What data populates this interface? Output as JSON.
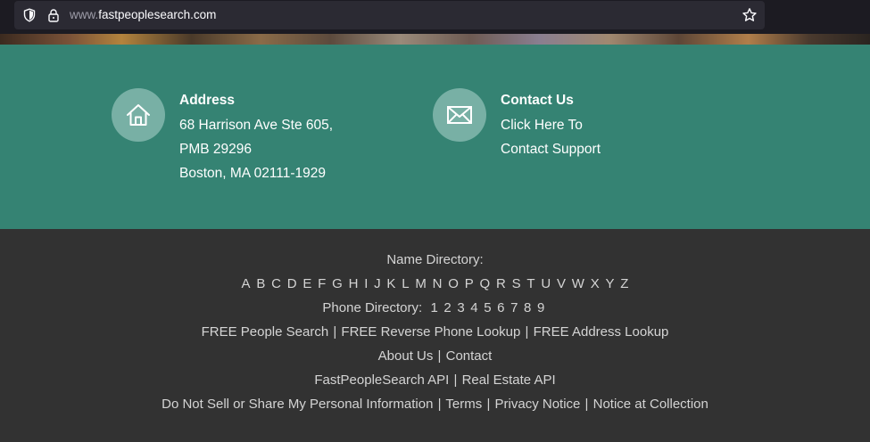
{
  "browser": {
    "url_host_prefix": "www.",
    "url_domain": "fastpeoplesearch.com"
  },
  "contact_band": {
    "address": {
      "heading": "Address",
      "line1": "68 Harrison Ave Ste 605,",
      "line2": "PMB 29296",
      "line3": "Boston, MA 02111-1929",
      "icon": "house-icon"
    },
    "contact": {
      "heading": "Contact Us",
      "line1": "Click Here To",
      "line2": "Contact Support",
      "icon": "envelope-icon"
    },
    "colors": {
      "band": "#358373",
      "icon_circle": "#78b0a5"
    }
  },
  "footer": {
    "name_directory_label": "Name Directory:",
    "letters": [
      "A",
      "B",
      "C",
      "D",
      "E",
      "F",
      "G",
      "H",
      "I",
      "J",
      "K",
      "L",
      "M",
      "N",
      "O",
      "P",
      "Q",
      "R",
      "S",
      "T",
      "U",
      "V",
      "W",
      "X",
      "Y",
      "Z"
    ],
    "phone_directory_label": "Phone Directory:",
    "digits": [
      "1",
      "2",
      "3",
      "4",
      "5",
      "6",
      "7",
      "8",
      "9"
    ],
    "free_people_search": "FREE People Search",
    "free_reverse_phone": "FREE Reverse Phone Lookup",
    "free_address_lookup": "FREE Address Lookup",
    "about_us": "About Us",
    "contact": "Contact",
    "api": "FastPeopleSearch API",
    "real_estate_api": "Real Estate API",
    "do_not_sell": "Do Not Sell or Share My Personal Information",
    "terms": "Terms",
    "privacy_notice": "Privacy Notice",
    "notice_at_collection": "Notice at Collection",
    "separator": "|"
  }
}
